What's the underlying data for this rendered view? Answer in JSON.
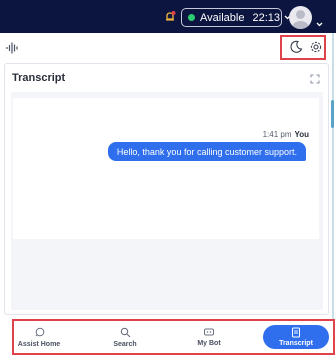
{
  "header": {
    "status_label": "Available",
    "timer": "22:13",
    "status_color": "#2ecc71",
    "bg_color": "#0c1440"
  },
  "panel": {
    "title": "Transcript"
  },
  "chat": {
    "messages": [
      {
        "time": "1:41 pm",
        "sender": "You",
        "text": "Hello, thank you for calling customer support."
      }
    ],
    "bubble_color": "#2f6fed"
  },
  "nav": {
    "items": [
      {
        "label": "Assist Home",
        "icon": "assist-home-icon"
      },
      {
        "label": "Search",
        "icon": "search-icon"
      },
      {
        "label": "My Bot",
        "icon": "bot-icon"
      },
      {
        "label": "Transcript",
        "icon": "transcript-icon",
        "active": true
      }
    ]
  },
  "highlight_color": "#e0424b"
}
